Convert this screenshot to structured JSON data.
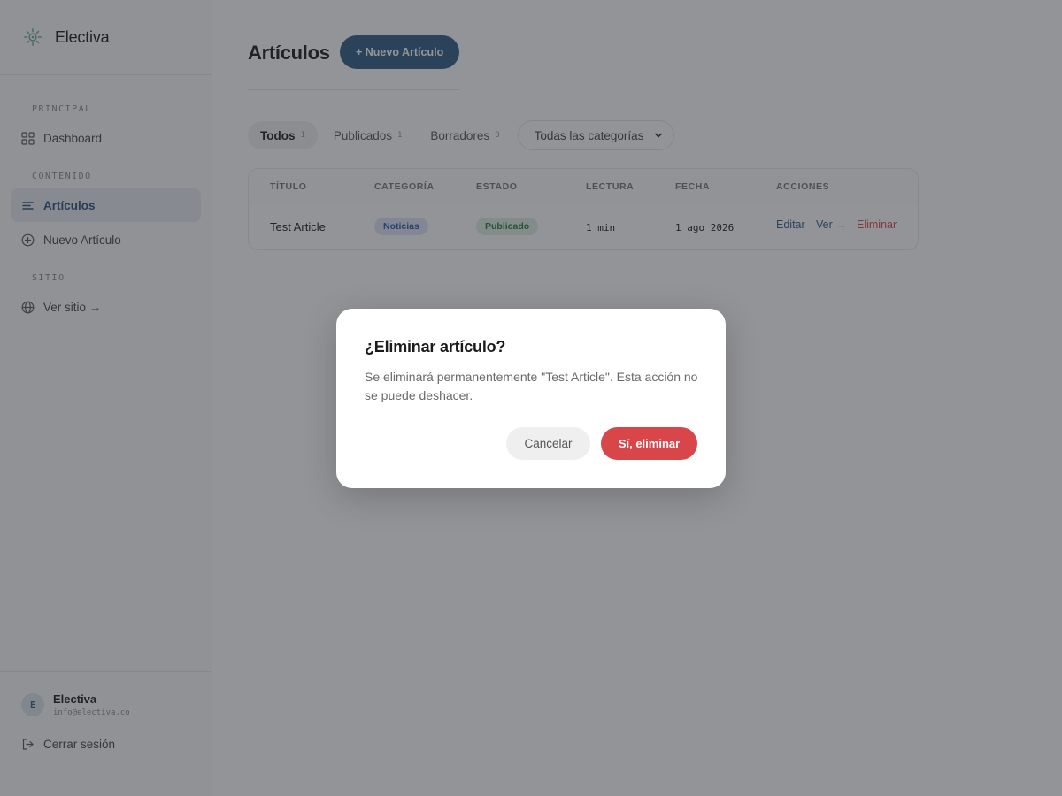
{
  "brand": {
    "name": "Electiva",
    "logo_icon": "gear-logo-icon"
  },
  "sidebar": {
    "sections": [
      {
        "label": "PRINCIPAL"
      },
      {
        "label": "CONTENIDO"
      },
      {
        "label": "SITIO"
      }
    ],
    "items": [
      {
        "label": "Dashboard",
        "icon": "grid-icon"
      },
      {
        "label": "Artículos",
        "icon": "list-icon",
        "active": true
      },
      {
        "label": "Nuevo Artículo",
        "icon": "plus-circle-icon"
      },
      {
        "label": "Ver sitio →",
        "icon": "globe-icon"
      }
    ],
    "footer": {
      "avatar_initial": "E",
      "user_name": "Electiva",
      "user_email": "info@electiva.co",
      "logout_label": "Cerrar sesión"
    }
  },
  "main": {
    "title": "Artículos",
    "new_button": "+ Nuevo Artículo",
    "tabs": [
      {
        "label": "Todos",
        "count": "1",
        "active": true
      },
      {
        "label": "Publicados",
        "count": "1"
      },
      {
        "label": "Borradores",
        "count": "0"
      }
    ],
    "category_filter": {
      "selected": "Todas las categorías"
    },
    "table": {
      "headers": [
        "TÍTULO",
        "CATEGORÍA",
        "ESTADO",
        "LECTURA",
        "FECHA",
        "ACCIONES"
      ],
      "rows": [
        {
          "title": "Test Article",
          "category": "Noticias",
          "status": "Publicado",
          "reading": "1 min",
          "date": "1 ago 2026",
          "actions": {
            "edit": "Editar",
            "view": "Ver →",
            "delete": "Eliminar"
          }
        }
      ]
    }
  },
  "modal": {
    "title": "¿Eliminar artículo?",
    "body": "Se eliminará permanentemente \"Test Article\". Esta acción no se puede deshacer.",
    "cancel_label": "Cancelar",
    "confirm_label": "Sí, eliminar"
  },
  "colors": {
    "primary": "#2e5a86",
    "danger": "#d9464a",
    "badge_blue": "#dce5f6",
    "badge_green": "#dcefe0"
  }
}
